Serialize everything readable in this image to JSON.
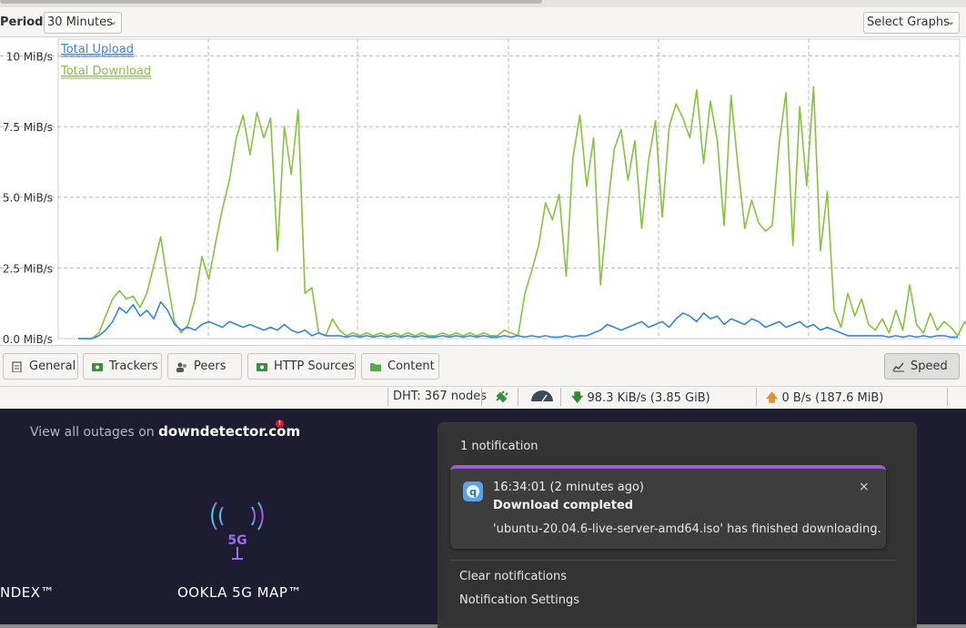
{
  "toolbar": {
    "period_label": "Period:",
    "period_value": "30 Minutes",
    "select_graphs": "Select Graphs"
  },
  "chart_data": {
    "type": "line",
    "title": "",
    "xlabel": "",
    "ylabel": "",
    "y_tick_labels": [
      "10 MiB/s",
      "7.5 MiB/s",
      "5.0 MiB/s",
      "2.5 MiB/s",
      "0.0 MiB/s"
    ],
    "y_ticks": [
      10,
      7.5,
      5.0,
      2.5,
      0.0
    ],
    "ylim": [
      0,
      10.4
    ],
    "grid": true,
    "legend_position": "top-left",
    "series": [
      {
        "name": "Total Upload",
        "color": "#3584e4",
        "values": [
          0,
          0,
          0,
          0.1,
          0.3,
          0.6,
          1.1,
          0.9,
          1.2,
          0.8,
          1.0,
          0.7,
          1.3,
          1.0,
          0.5,
          0.3,
          0.4,
          0.3,
          0.5,
          0.6,
          0.5,
          0.4,
          0.6,
          0.5,
          0.4,
          0.5,
          0.4,
          0.3,
          0.4,
          0.3,
          0.5,
          0.3,
          0.2,
          0.3,
          0.1,
          0.2,
          0.1,
          0.1,
          0.1,
          0.05,
          0.1,
          0.05,
          0.1,
          0.05,
          0.1,
          0.05,
          0.1,
          0.05,
          0.1,
          0.05,
          0.1,
          0.05,
          0.05,
          0.1,
          0.05,
          0.1,
          0.05,
          0.1,
          0.05,
          0.1,
          0.05,
          0.05,
          0.1,
          0.05,
          0.1,
          0.05,
          0.1,
          0.05,
          0.1,
          0.05,
          0.05,
          0.1,
          0.05,
          0.1,
          0.1,
          0.2,
          0.3,
          0.5,
          0.4,
          0.3,
          0.4,
          0.5,
          0.6,
          0.4,
          0.5,
          0.6,
          0.4,
          0.7,
          0.9,
          0.8,
          0.6,
          0.9,
          0.7,
          0.8,
          0.5,
          0.7,
          0.6,
          0.5,
          0.7,
          0.6,
          0.4,
          0.5,
          0.6,
          0.4,
          0.5,
          0.6,
          0.4,
          0.5,
          0.3,
          0.4,
          0.3,
          0.2,
          0.1,
          0.1,
          0.1,
          0.1,
          0.1,
          0.1,
          0.05,
          0.1,
          0.05,
          0.1,
          0.05,
          0.1,
          0.05,
          0.1,
          0.1,
          0.05,
          0.05
        ]
      },
      {
        "name": "Total Download",
        "color": "#86c240",
        "values": [
          0,
          0,
          0,
          0.2,
          0.8,
          1.4,
          1.7,
          1.4,
          1.5,
          1.1,
          1.6,
          2.6,
          3.6,
          2.0,
          0.6,
          0.2,
          0.5,
          1.4,
          2.9,
          2.1,
          3.4,
          4.6,
          5.6,
          7.1,
          7.9,
          6.5,
          8.0,
          7.1,
          7.8,
          3.1,
          7.5,
          5.8,
          8.1,
          1.6,
          1.8,
          0.2,
          0.1,
          0.7,
          0.3,
          0.1,
          0.2,
          0.1,
          0.2,
          0.1,
          0.2,
          0.1,
          0.2,
          0.1,
          0.2,
          0.1,
          0.2,
          0.1,
          0.1,
          0.2,
          0.1,
          0.2,
          0.1,
          0.2,
          0.1,
          0.2,
          0.1,
          0.1,
          0.3,
          0.2,
          0.1,
          1.6,
          2.4,
          3.3,
          4.8,
          4.2,
          5.1,
          2.2,
          6.4,
          7.9,
          5.4,
          7.1,
          1.9,
          4.5,
          6.7,
          7.4,
          5.6,
          7.0,
          3.9,
          6.3,
          7.7,
          4.3,
          7.5,
          8.3,
          7.8,
          7.1,
          8.8,
          6.2,
          8.4,
          7.0,
          4.0,
          8.6,
          6.1,
          3.9,
          4.9,
          4.1,
          3.8,
          4.0,
          6.9,
          8.7,
          3.3,
          8.2,
          5.4,
          8.9,
          3.1,
          5.2,
          1.0,
          0.4,
          1.6,
          0.8,
          1.4,
          0.5,
          0.3,
          0.7,
          0.2,
          1.0,
          0.3,
          1.9,
          0.5,
          0.2,
          0.9,
          0.3,
          0.6,
          0.4,
          0.1,
          0.6,
          0.2
        ]
      }
    ]
  },
  "tabs": [
    {
      "label": "General"
    },
    {
      "label": "Trackers"
    },
    {
      "label": "Peers"
    },
    {
      "label": "HTTP Sources"
    },
    {
      "label": "Content"
    },
    {
      "label": "Speed"
    }
  ],
  "statusbar": {
    "dht": "DHT: 367 nodes",
    "download": "98.3 KiB/s (3.85 GiB)",
    "upload": "0 B/s (187.6 MiB)"
  },
  "web": {
    "outages_prefix": "View all outages on",
    "outages_site": "downdetector.com",
    "index_label": "NDEX™",
    "ookla_label": "OOKLA 5G MAP™",
    "fiveg_text": "5G"
  },
  "notification": {
    "count": "1 notification",
    "time": "16:34:01 (2 minutes ago)",
    "title": "Download completed",
    "body": "'ubuntu-20.04.6-live-server-amd64.iso' has finished downloading.",
    "close": "×",
    "clear": "Clear notifications",
    "settings": "Notification Settings"
  }
}
